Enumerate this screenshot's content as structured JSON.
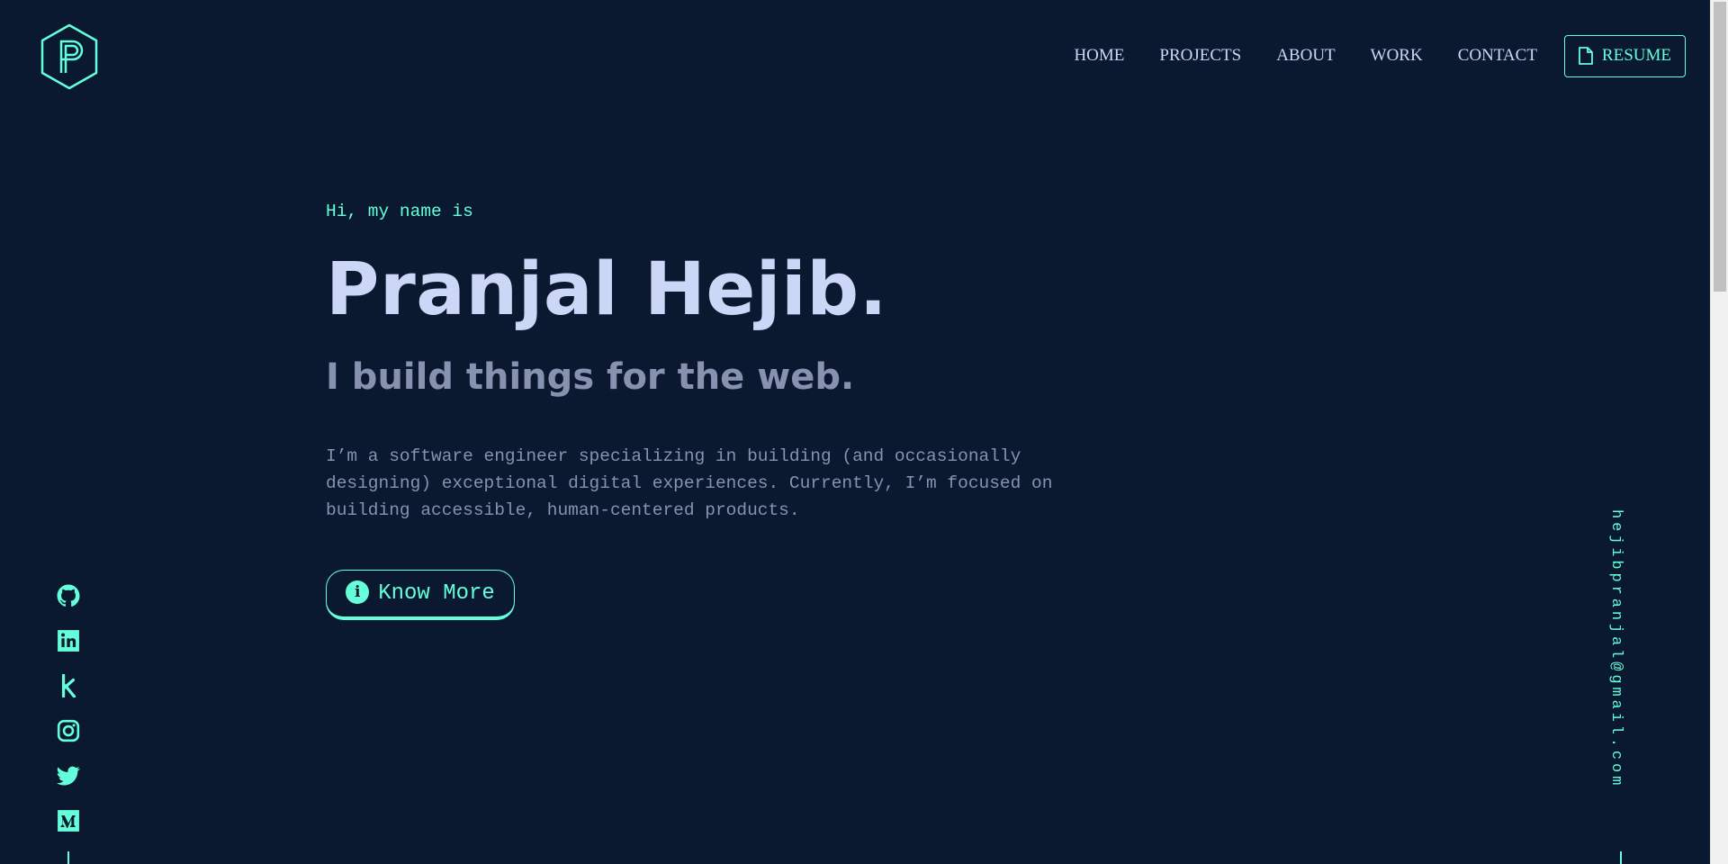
{
  "brand": {
    "logo_icon": "hexagon-p-logo",
    "accent": "#64ffda",
    "background": "#0a192f"
  },
  "nav": {
    "items": [
      {
        "label": "HOME"
      },
      {
        "label": "PROJECTS"
      },
      {
        "label": "ABOUT"
      },
      {
        "label": "WORK"
      },
      {
        "label": "CONTACT"
      }
    ],
    "resume_label": "RESUME",
    "resume_icon": "file-icon"
  },
  "hero": {
    "greeting": "Hi, my name is",
    "name": "Pranjal Hejib.",
    "tagline": "I build things for the web.",
    "bio": "I’m a software engineer specializing in building (and occasionally designing) exceptional digital experiences. Currently, I’m focused on building accessible, human-centered products.",
    "cta_label": "Know More",
    "cta_icon": "info-icon",
    "cta_icon_glyph": "i"
  },
  "socials": [
    {
      "name": "github-icon"
    },
    {
      "name": "linkedin-icon"
    },
    {
      "name": "kaggle-icon"
    },
    {
      "name": "instagram-icon"
    },
    {
      "name": "twitter-icon"
    },
    {
      "name": "medium-icon"
    }
  ],
  "email": "hejibpranjal@gmail.com"
}
